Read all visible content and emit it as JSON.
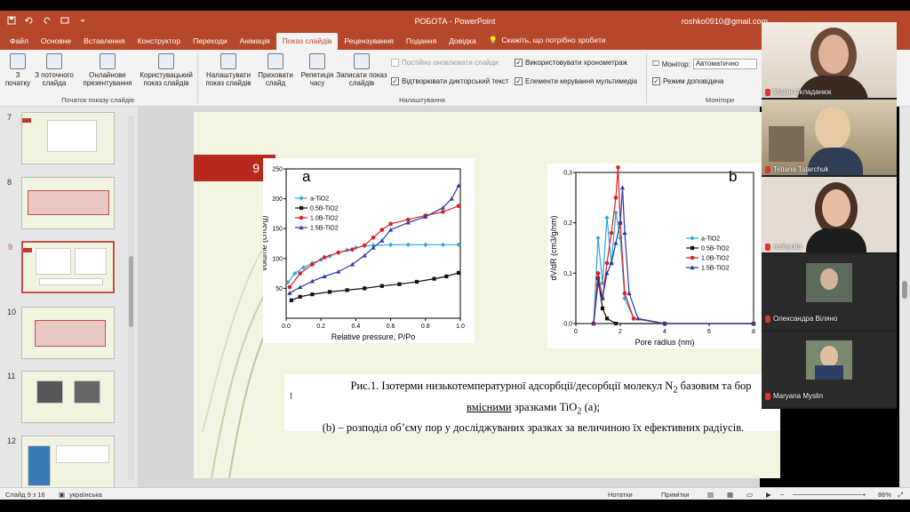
{
  "window": {
    "title": "РОБОТА  -  PowerPoint",
    "user": "roshko0910@gmail.com"
  },
  "tabs": [
    {
      "label": "Файл"
    },
    {
      "label": "Основне"
    },
    {
      "label": "Вставлення"
    },
    {
      "label": "Конструктор"
    },
    {
      "label": "Переходи"
    },
    {
      "label": "Анімація"
    },
    {
      "label": "Показ слайдів",
      "active": true
    },
    {
      "label": "Рецензування"
    },
    {
      "label": "Подання"
    },
    {
      "label": "Довідка"
    }
  ],
  "tell_me": "Скажіть, що потрібно зробити",
  "ribbon": {
    "from_start": "З початку",
    "from_current": "З поточного слайда",
    "online": "Онлайнове презентування",
    "custom": "Користувацький показ слайдів",
    "group1": "Початок показу слайдів",
    "setup": "Налаштувати показ слайдів",
    "hide": "Приховати слайд",
    "rehearse": "Репетиція часу",
    "record": "Записати показ слайдів",
    "keep_updated": "Постійно оновлювати слайди",
    "play_narrations": "Відтворювати дикторський текст",
    "use_timings": "Використовувати хронометраж",
    "show_controls": "Елементи керування мультимедіа",
    "group2": "Налаштування",
    "monitor_label": "Монітор:",
    "monitor_value": "Автоматично",
    "presenter_view": "Режим доповідача",
    "group3": "Монітори"
  },
  "thumbnails": [
    {
      "num": "7"
    },
    {
      "num": "8"
    },
    {
      "num": "9",
      "active": true
    },
    {
      "num": "10"
    },
    {
      "num": "11"
    },
    {
      "num": "12"
    }
  ],
  "slide": {
    "number": "9",
    "caption_line1a": "Рис.1. Ізотерми низькотемпературної адсорбції/десорбції молекул N",
    "caption_line1_sub": "2",
    "caption_line1b": " базовим та бор",
    "caption_line2_ul": "вмісними",
    "caption_line2b": " зразками TiO",
    "caption_line2_sub": "2",
    "caption_line2c": " (a);",
    "caption_line3": "(b) – розподіл об’єму пор у досліджуваних зразках за величиною їх ефективних радіусів."
  },
  "chart_data": [
    {
      "type": "line",
      "panel_label": "a",
      "xlabel": "Relative pressure, P/Po",
      "ylabel": "Volume (cm3/g)",
      "xlim": [
        0,
        1.0
      ],
      "ylim": [
        0,
        250
      ],
      "xticks": [
        "0.0",
        "0.2",
        "0.4",
        "0.6",
        "0.8",
        "1.0"
      ],
      "yticks": [
        "50",
        "100",
        "150",
        "200",
        "250"
      ],
      "series": [
        {
          "name": "a-TiO2",
          "color": "#29a8e0",
          "marker": "diamond",
          "points": [
            [
              0.01,
              60
            ],
            [
              0.05,
              75
            ],
            [
              0.1,
              85
            ],
            [
              0.15,
              92
            ],
            [
              0.2,
              98
            ],
            [
              0.25,
              104
            ],
            [
              0.3,
              110
            ],
            [
              0.35,
              114
            ],
            [
              0.4,
              118
            ],
            [
              0.45,
              121
            ],
            [
              0.5,
              122
            ],
            [
              0.6,
              123
            ],
            [
              0.7,
              123
            ],
            [
              0.8,
              123
            ],
            [
              0.9,
              123
            ],
            [
              0.99,
              123
            ]
          ]
        },
        {
          "name": "0.5B-TiO2",
          "color": "#111111",
          "marker": "square",
          "points": [
            [
              0.03,
              30
            ],
            [
              0.08,
              36
            ],
            [
              0.15,
              40
            ],
            [
              0.25,
              44
            ],
            [
              0.35,
              47
            ],
            [
              0.45,
              50
            ],
            [
              0.55,
              54
            ],
            [
              0.65,
              57
            ],
            [
              0.75,
              61
            ],
            [
              0.85,
              66
            ],
            [
              0.92,
              70
            ],
            [
              0.99,
              76
            ]
          ]
        },
        {
          "name": "1.0B-TiO2",
          "color": "#e02020",
          "marker": "circle",
          "points": [
            [
              0.02,
              52
            ],
            [
              0.08,
              75
            ],
            [
              0.15,
              90
            ],
            [
              0.22,
              102
            ],
            [
              0.3,
              110
            ],
            [
              0.38,
              115
            ],
            [
              0.45,
              122
            ],
            [
              0.5,
              135
            ],
            [
              0.55,
              148
            ],
            [
              0.6,
              158
            ],
            [
              0.7,
              165
            ],
            [
              0.8,
              172
            ],
            [
              0.9,
              178
            ],
            [
              0.99,
              188
            ]
          ]
        },
        {
          "name": "1.5B-TiO2",
          "color": "#2b3aa8",
          "marker": "triangle",
          "points": [
            [
              0.02,
              42
            ],
            [
              0.08,
              52
            ],
            [
              0.15,
              62
            ],
            [
              0.22,
              70
            ],
            [
              0.3,
              78
            ],
            [
              0.38,
              90
            ],
            [
              0.45,
              105
            ],
            [
              0.5,
              118
            ],
            [
              0.55,
              130
            ],
            [
              0.6,
              148
            ],
            [
              0.7,
              160
            ],
            [
              0.8,
              170
            ],
            [
              0.9,
              185
            ],
            [
              0.95,
              200
            ],
            [
              0.99,
              222
            ]
          ]
        }
      ]
    },
    {
      "type": "line",
      "panel_label": "b",
      "xlabel": "Pore radius (nm)",
      "ylabel": "dV/dR  (cm3/g/nm)",
      "xlim": [
        0,
        8
      ],
      "ylim": [
        0,
        0.3
      ],
      "xticks": [
        "0",
        "2",
        "4",
        "6",
        "8"
      ],
      "yticks": [
        "0,0",
        "0,1",
        "0,2",
        "0,3"
      ],
      "series": [
        {
          "name": "a-TiO2",
          "color": "#29a8e0",
          "marker": "diamond",
          "points": [
            [
              0.8,
              0.0
            ],
            [
              1.0,
              0.17
            ],
            [
              1.2,
              0.08
            ],
            [
              1.4,
              0.21
            ],
            [
              1.6,
              0.12
            ],
            [
              1.8,
              0.22
            ],
            [
              2.0,
              0.17
            ],
            [
              2.2,
              0.05
            ],
            [
              2.6,
              0.01
            ],
            [
              4,
              0.0
            ],
            [
              8,
              0.0
            ]
          ]
        },
        {
          "name": "0.5B-TiO2",
          "color": "#111111",
          "marker": "square",
          "points": [
            [
              0.8,
              0.0
            ],
            [
              1.0,
              0.09
            ],
            [
              1.2,
              0.03
            ],
            [
              1.4,
              0.01
            ],
            [
              1.8,
              0.0
            ],
            [
              4,
              0.0
            ],
            [
              8,
              0.0
            ]
          ]
        },
        {
          "name": "1.0B-TiO2",
          "color": "#e02020",
          "marker": "circle",
          "points": [
            [
              0.8,
              0.0
            ],
            [
              1.0,
              0.1
            ],
            [
              1.2,
              0.05
            ],
            [
              1.4,
              0.12
            ],
            [
              1.6,
              0.18
            ],
            [
              1.8,
              0.25
            ],
            [
              1.9,
              0.31
            ],
            [
              2.0,
              0.2
            ],
            [
              2.2,
              0.06
            ],
            [
              2.6,
              0.01
            ],
            [
              4,
              0.0
            ],
            [
              8,
              0.0
            ]
          ]
        },
        {
          "name": "1.5B-TiO2",
          "color": "#2b3aa8",
          "marker": "triangle",
          "points": [
            [
              0.8,
              0.0
            ],
            [
              1.0,
              0.08
            ],
            [
              1.2,
              0.05
            ],
            [
              1.4,
              0.1
            ],
            [
              1.6,
              0.12
            ],
            [
              1.8,
              0.16
            ],
            [
              2.0,
              0.2
            ],
            [
              2.1,
              0.27
            ],
            [
              2.2,
              0.18
            ],
            [
              2.4,
              0.06
            ],
            [
              2.8,
              0.01
            ],
            [
              4,
              0.0
            ],
            [
              8,
              0.0
            ]
          ]
        }
      ]
    }
  ],
  "status": {
    "slide_of": "Слайд 9 з 16",
    "language": "українська",
    "notes": "Нотатки",
    "comments": "Примітки",
    "zoom": "86%"
  },
  "participants": [
    {
      "name": "Марія Складанюк",
      "bg": "#6b5a4a"
    },
    {
      "name": "Tetiana Tatarchuk",
      "bg": "#8a7a5e"
    },
    {
      "name": "roshyulia",
      "bg": "#d9d2c8"
    },
    {
      "name": "Олександра Віляно",
      "bg": "#2a2a2a"
    },
    {
      "name": "Maryana Myslin",
      "bg": "#2a2a2a"
    }
  ]
}
